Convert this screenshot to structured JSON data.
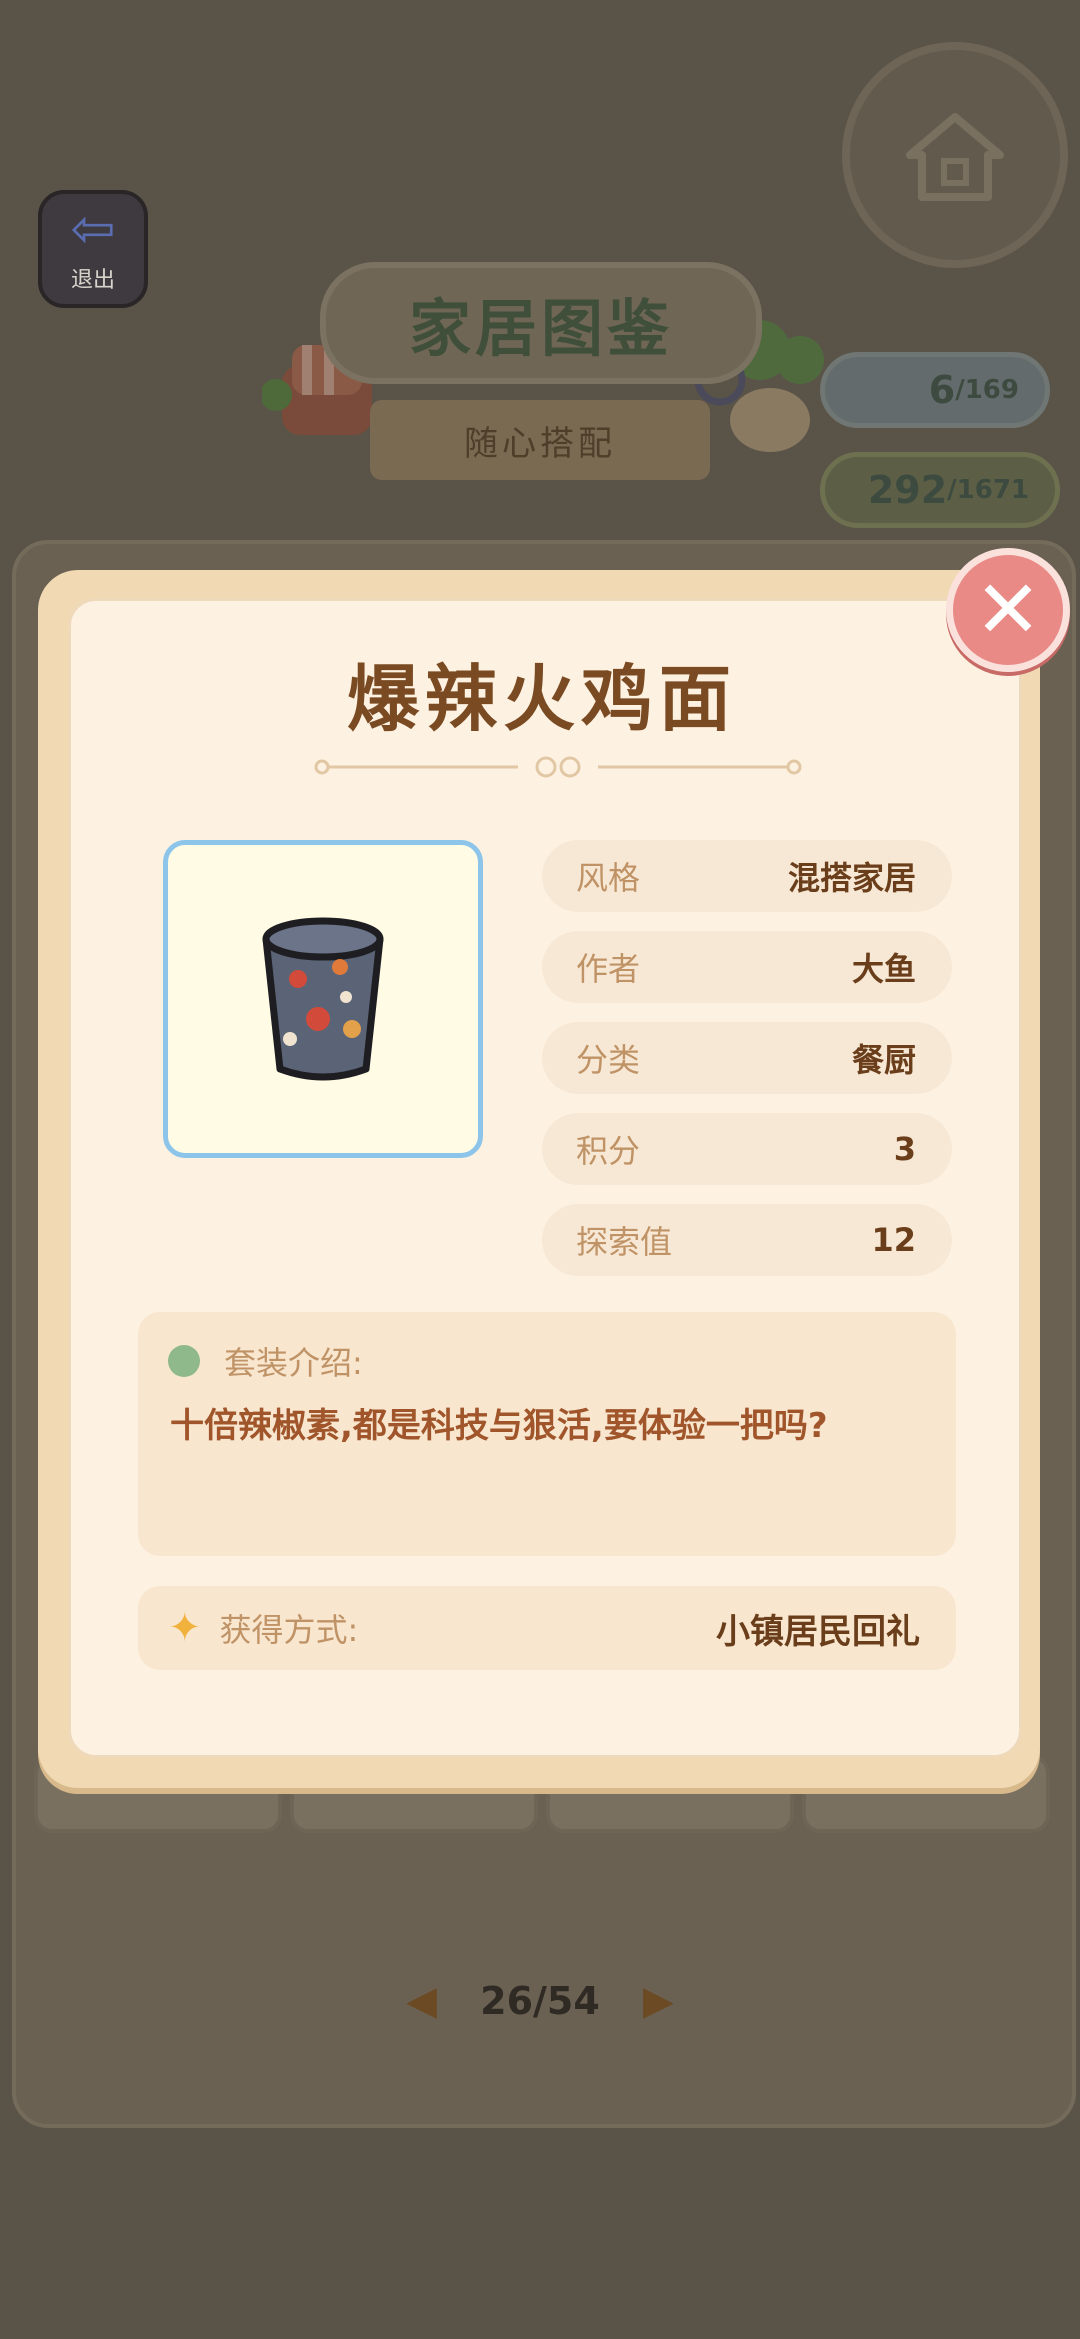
{
  "background": {
    "exit_label": "退出",
    "title": "家居图鉴",
    "subtitle": "随心搭配",
    "stat_explore": {
      "value": "6",
      "total": "/169"
    },
    "stat_points": {
      "value": "292",
      "total": "/1671"
    },
    "pager": {
      "current_total": "26/54"
    }
  },
  "modal": {
    "title": "爆辣火鸡面",
    "attributes": [
      {
        "key": "风格",
        "value": "混搭家居"
      },
      {
        "key": "作者",
        "value": "大鱼"
      },
      {
        "key": "分类",
        "value": "餐厨"
      },
      {
        "key": "积分",
        "value": "3"
      },
      {
        "key": "探索值",
        "value": "12"
      }
    ],
    "description_label": "套装介绍:",
    "description_text": "十倍辣椒素,都是科技与狠活,要体验一把吗?",
    "obtain_label": "获得方式:",
    "obtain_value": "小镇居民回礼"
  },
  "colors": {
    "accent_title": "#7a4a22",
    "close_button": "#e98a86",
    "thumb_border": "#8cc4ea"
  }
}
